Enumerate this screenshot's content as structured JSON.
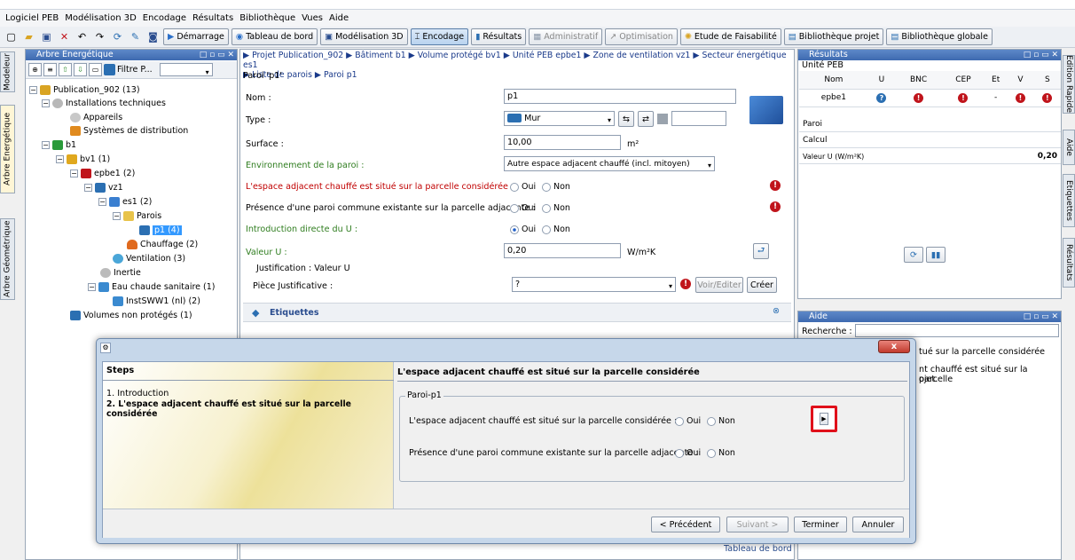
{
  "menu": [
    "Logiciel PEB",
    "Modélisation 3D",
    "Encodage",
    "Résultats",
    "Bibliothèque",
    "Vues",
    "Aide"
  ],
  "toolbar": {
    "demarrage": "Démarrage",
    "tableau": "Tableau de bord",
    "modelisation": "Modélisation 3D",
    "encodage": "Encodage",
    "resultats": "Résultats",
    "administratif": "Administratif",
    "optimisation": "Optimisation",
    "faisabilite": "Etude de Faisabilité",
    "biblio_projet": "Bibliothèque projet",
    "biblio_globale": "Bibliothèque globale"
  },
  "left_tabs": [
    "Modeleur",
    "Arbre Energétique",
    "Arbre Géométrique"
  ],
  "right_tabs": [
    "Edition Rapide",
    "Aide",
    "Etiquettes",
    "Résultats"
  ],
  "tree": {
    "title": "Arbre Energétique",
    "filter": "Filtre P...",
    "nodes": [
      "Publication_902 (13)",
      "Installations techniques",
      "Appareils",
      "Systèmes de distribution",
      "b1",
      "bv1 (1)",
      "epbe1 (2)",
      "vz1",
      "es1 (2)",
      "Parois",
      "p1 (4)",
      "Chauffage (2)",
      "Ventilation (3)",
      "Inertie",
      "Eau chaude sanitaire (1)",
      "InstSWW1 (nl) (2)",
      "Volumes non protégés (1)"
    ]
  },
  "center": {
    "breadcrumb": [
      "Projet Publication_902",
      "Bâtiment b1",
      "Volume protégé bv1",
      "Unité PEB epbe1",
      "Zone de ventilation vz1",
      "Secteur énergétique es1",
      "Liste de parois",
      "Paroi p1"
    ],
    "paroi_title": "Paroi 'p1'",
    "nom_label": "Nom :",
    "nom_value": "p1",
    "type_label": "Type :",
    "type_value": "Mur",
    "surface_label": "Surface :",
    "surface_value": "10,00",
    "surface_unit": "m²",
    "env_label": "Environnement de la paroi :",
    "env_value": "Autre espace adjacent chauffé (incl. mitoyen)",
    "q1_label": "L'espace adjacent chauffé est situé sur la parcelle considérée :",
    "q2_label": "Présence d'une paroi commune existante sur la parcelle adjacente :",
    "q3_label": "Introduction directe du U :",
    "oui": "Oui",
    "non": "Non",
    "u_label": "Valeur U :",
    "u_value": "0,20",
    "u_unit": "W/m²K",
    "justif_title": "Justification : Valeur U",
    "piece_label": "Pièce Justificative :",
    "piece_value": "?",
    "voir_editer": "Voir/Editer",
    "creer": "Créer",
    "etiquettes": "Etiquettes",
    "tableau_link": "Tableau de bord"
  },
  "results": {
    "title": "Résultats",
    "unit": "Unité PEB",
    "cols": [
      "Nom",
      "U",
      "BNC",
      "CEP",
      "Et",
      "V",
      "S"
    ],
    "row": [
      "epbe1",
      "?",
      "!",
      "!",
      "-",
      "!",
      "!"
    ],
    "paroi": "Paroi",
    "calcul": "Calcul",
    "valeur_u_label": "Valeur U (W/m²K)",
    "valeur_u": "0,20"
  },
  "aide": {
    "title": "Aide",
    "recherche": "Recherche :",
    "line1": "tué sur la parcelle considérée",
    "line2": "nt chauffé est situé sur la parcelle",
    "line3": "ojet."
  },
  "dialog": {
    "steps_title": "Steps",
    "step1": "1. Introduction",
    "step2": "2. L'espace adjacent chauffé est situé sur la parcelle considérée",
    "title": "L'espace adjacent chauffé est situé sur la parcelle considérée",
    "group": "Paroi-p1",
    "q1": "L'espace adjacent chauffé est situé sur la parcelle considérée :",
    "q2": "Présence d'une paroi commune existante sur la parcelle adjacente :",
    "oui": "Oui",
    "non": "Non",
    "close": "x",
    "prev": "< Précédent",
    "next": "Suivant >",
    "finish": "Terminer",
    "cancel": "Annuler"
  },
  "colors": {
    "warning": "#c0141b",
    "accent": "#3e6ab0",
    "highlight": "#e0101a"
  }
}
